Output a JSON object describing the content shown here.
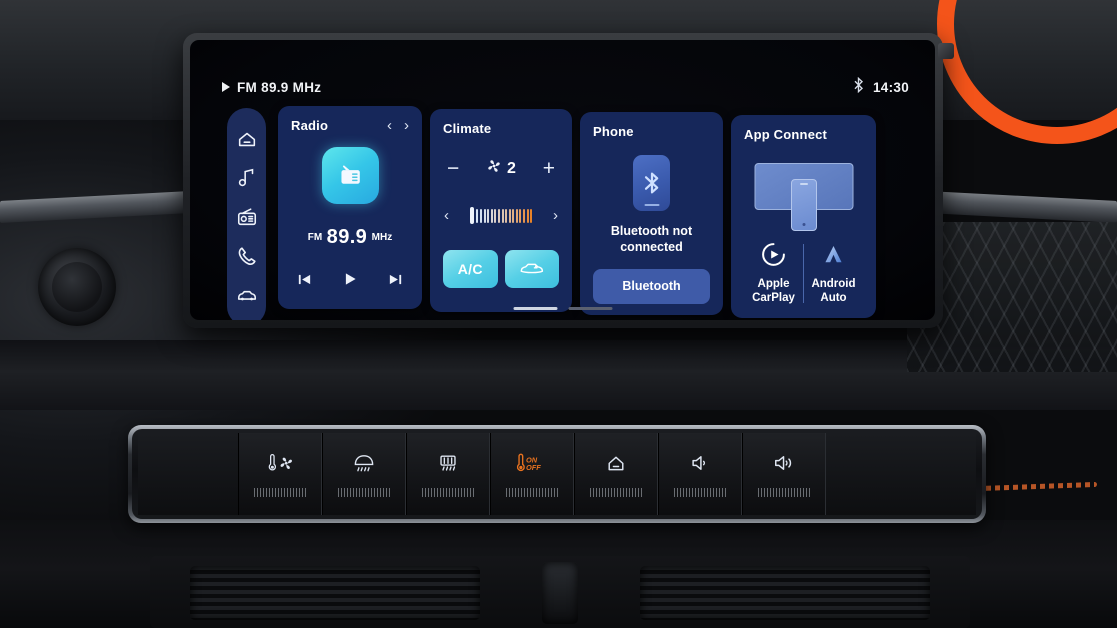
{
  "screen": {
    "statusbar": {
      "play_icon": "play-triangle-icon",
      "source_label": "FM 89.9 MHz",
      "bluetooth_icon": "bluetooth-icon",
      "time": "14:30"
    },
    "sidebar": {
      "items": [
        {
          "name": "home",
          "icon": "home-icon"
        },
        {
          "name": "media",
          "icon": "music-note-icon"
        },
        {
          "name": "radio",
          "icon": "radio-icon"
        },
        {
          "name": "phone",
          "icon": "phone-handset-icon"
        },
        {
          "name": "vehicle",
          "icon": "car-icon"
        }
      ]
    },
    "cards": {
      "radio": {
        "title": "Radio",
        "prev_icon": "chevron-left-icon",
        "next_icon": "chevron-right-icon",
        "prev_label": "‹",
        "next_label": "›",
        "app_icon": "radio-app-icon",
        "band": "FM",
        "frequency": "89.9",
        "unit": "MHz",
        "transport": {
          "previous_icon": "skip-previous-icon",
          "play_icon": "play-icon",
          "next_icon": "skip-next-icon"
        }
      },
      "climate": {
        "title": "Climate",
        "minus_label": "−",
        "plus_label": "+",
        "fan_icon": "fan-icon",
        "fan_speed": "2",
        "temp_prev_label": "‹",
        "temp_next_label": "›",
        "temp_bar_count": 16,
        "temp_level": 1,
        "buttons": [
          {
            "label": "A/C",
            "name": "ac-toggle",
            "icon": "",
            "active": true
          },
          {
            "label": "",
            "name": "air-recirculation-toggle",
            "icon": "recirculation-icon",
            "active": true
          }
        ]
      },
      "phone": {
        "title": "Phone",
        "device_icon": "phone-bluetooth-icon",
        "status": "Bluetooth not connected",
        "button_label": "Bluetooth"
      },
      "app_connect": {
        "title": "App Connect",
        "graphic_icon": "screen-mirroring-icon",
        "options": [
          {
            "label": "Apple\nCarPlay",
            "icon": "apple-carplay-icon"
          },
          {
            "label": "Android\nAuto",
            "icon": "android-auto-icon"
          }
        ],
        "option_apple_line1": "Apple",
        "option_apple_line2": "CarPlay",
        "option_android_line1": "Android",
        "option_android_line2": "Auto"
      }
    },
    "page_indicator": {
      "total": 2,
      "active": 1
    }
  },
  "physical_buttons": [
    {
      "name": "climate-control-button",
      "icon": "thermometer-fan-icon",
      "color": "#dfe6f2"
    },
    {
      "name": "front-defrost-button",
      "icon": "front-defrost-icon",
      "color": "#dfe6f2"
    },
    {
      "name": "rear-defrost-button",
      "icon": "rear-defrost-icon",
      "color": "#dfe6f2"
    },
    {
      "name": "ac-onoff-button",
      "icon": "thermometer-onoff-icon",
      "color": "#e8721f",
      "label_on": "ON",
      "label_off": "OFF"
    },
    {
      "name": "home-button",
      "icon": "home-icon",
      "color": "#dfe6f2"
    },
    {
      "name": "volume-down-button",
      "icon": "volume-low-icon",
      "color": "#dfe6f2"
    },
    {
      "name": "volume-up-button",
      "icon": "volume-high-icon",
      "color": "#dfe6f2"
    }
  ],
  "colors": {
    "card_bg": "#16275a",
    "sidebar_bg": "#1d2c5c",
    "accent_cyan": "#55cfe6",
    "accent_orange": "#e8721f",
    "button_blue": "#3f5ba8"
  }
}
